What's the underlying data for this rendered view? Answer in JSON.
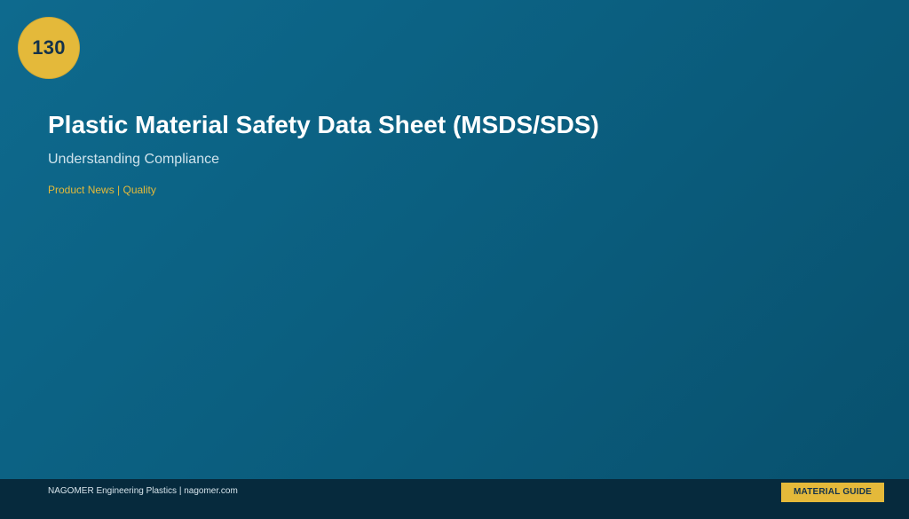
{
  "badge": {
    "number": "130"
  },
  "hero": {
    "title": "Plastic Material Safety Data Sheet (MSDS/SDS)",
    "subtitle": "Understanding Compliance",
    "tags": "Product News | Quality"
  },
  "footer": {
    "company": "NAGOMER Engineering Plastics | nagomer.com",
    "label": "MATERIAL GUIDE"
  },
  "colors": {
    "background": "#0b5f80",
    "accent": "#e4b93a",
    "footer": "#062a3d",
    "title": "#ffffff"
  }
}
